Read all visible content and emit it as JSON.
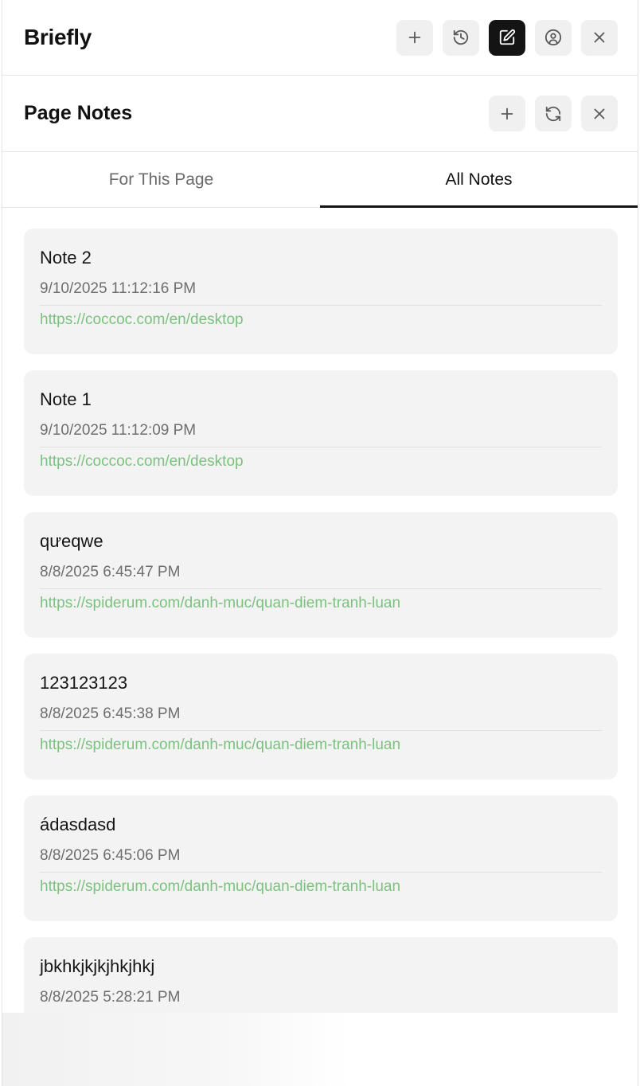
{
  "app": {
    "title": "Briefly"
  },
  "header_icons": [
    {
      "name": "plus-icon",
      "active": false
    },
    {
      "name": "history-icon",
      "active": false
    },
    {
      "name": "edit-note-icon",
      "active": true
    },
    {
      "name": "user-circle-icon",
      "active": false
    },
    {
      "name": "close-icon",
      "active": false
    }
  ],
  "section": {
    "title": "Page Notes",
    "icons": [
      "plus-icon",
      "refresh-icon",
      "close-icon"
    ]
  },
  "tabs": [
    {
      "label": "For This Page",
      "selected": false
    },
    {
      "label": "All Notes",
      "selected": true
    }
  ],
  "notes": [
    {
      "title": "Note 2",
      "date": "9/10/2025 11:12:16 PM",
      "url": "https://coccoc.com/en/desktop"
    },
    {
      "title": "Note 1",
      "date": "9/10/2025 11:12:09 PM",
      "url": "https://coccoc.com/en/desktop"
    },
    {
      "title": "qưeqwe",
      "date": "8/8/2025 6:45:47 PM",
      "url": "https://spiderum.com/danh-muc/quan-diem-tranh-luan"
    },
    {
      "title": "123123123",
      "date": "8/8/2025 6:45:38 PM",
      "url": "https://spiderum.com/danh-muc/quan-diem-tranh-luan"
    },
    {
      "title": "ádasdasd",
      "date": "8/8/2025 6:45:06 PM",
      "url": "https://spiderum.com/danh-muc/quan-diem-tranh-luan"
    },
    {
      "title": "jbkhkjkjkjhkjhkj",
      "date": "8/8/2025 5:28:21 PM",
      "url": ""
    }
  ],
  "colors": {
    "accent_dark": "#141414",
    "url_green": "#7bc27f",
    "card_bg": "#f3f3f3"
  }
}
